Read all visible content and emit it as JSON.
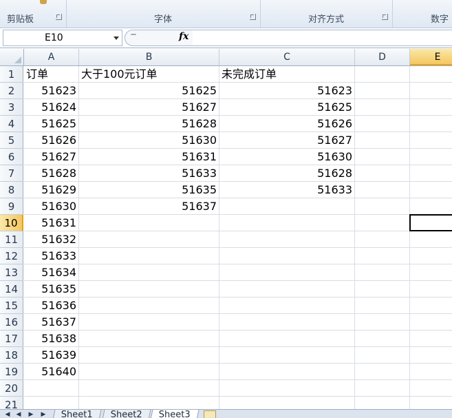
{
  "ribbon": {
    "groups": [
      {
        "label": "剪贴板"
      },
      {
        "label": "字体"
      },
      {
        "label": "对齐方式"
      },
      {
        "label": "数字"
      }
    ]
  },
  "formula_bar": {
    "name_box": "E10",
    "fx_label": "fx",
    "formula": ""
  },
  "grid": {
    "columns": [
      "A",
      "B",
      "C",
      "D",
      "E"
    ],
    "active_column": "E",
    "rows": [
      "1",
      "2",
      "3",
      "4",
      "5",
      "6",
      "7",
      "8",
      "9",
      "10",
      "11",
      "12",
      "13",
      "14",
      "15",
      "16",
      "17",
      "18",
      "19",
      "20",
      "21"
    ],
    "active_row": "10",
    "cells": {
      "A1": "订单",
      "B1": "大于100元订单",
      "C1": "未完成订单",
      "A2": "51623",
      "B2": "51625",
      "C2": "51623",
      "A3": "51624",
      "B3": "51627",
      "C3": "51625",
      "A4": "51625",
      "B4": "51628",
      "C4": "51626",
      "A5": "51626",
      "B5": "51630",
      "C5": "51627",
      "A6": "51627",
      "B6": "51631",
      "C6": "51630",
      "A7": "51628",
      "B7": "51633",
      "C7": "51628",
      "A8": "51629",
      "B8": "51635",
      "C8": "51633",
      "A9": "51630",
      "B9": "51637",
      "A10": "51631",
      "A11": "51632",
      "A12": "51633",
      "A13": "51634",
      "A14": "51635",
      "A15": "51636",
      "A16": "51637",
      "A17": "51638",
      "A18": "51639",
      "A19": "51640"
    }
  },
  "sheet_tabs": {
    "tabs": [
      "Sheet1",
      "Sheet2",
      "Sheet3"
    ],
    "active": "Sheet3",
    "nav": [
      "first-sheet",
      "prev-sheet",
      "next-sheet",
      "last-sheet"
    ]
  },
  "colors": {
    "accent": "#f5c760",
    "selection": "#000000",
    "gridline": "#d8dde3"
  }
}
